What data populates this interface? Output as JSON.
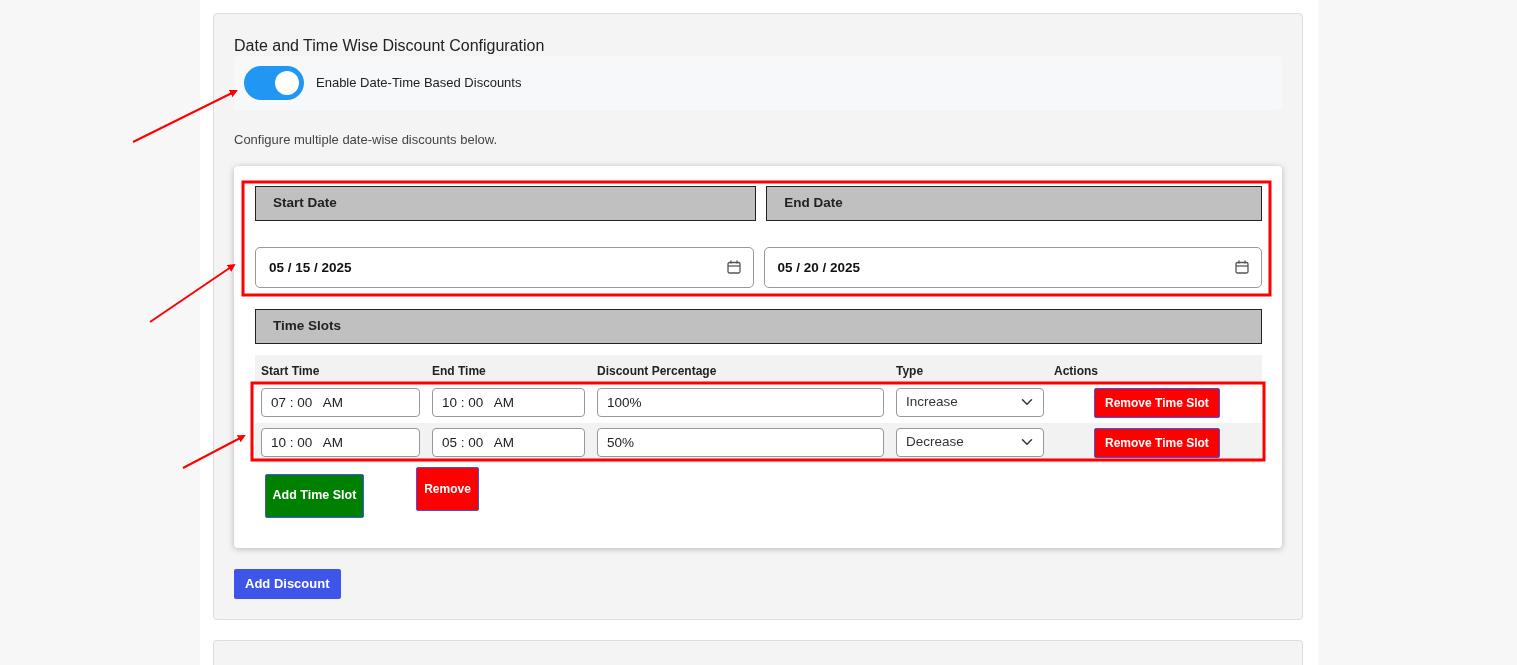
{
  "section_title": "Date and Time Wise Discount Configuration",
  "toggle": {
    "label": "Enable Date-Time Based Discounts",
    "on": true
  },
  "description": "Configure multiple date-wise discounts below.",
  "date_fields": [
    {
      "label": "Start Date",
      "value": "05 / 15 / 2025"
    },
    {
      "label": "End Date",
      "value": "05 / 20 / 2025"
    }
  ],
  "time_slots_heading": "Time Slots",
  "columns": [
    "Start Time",
    "End Time",
    "Discount Percentage",
    "Type",
    "Actions"
  ],
  "time_slots": [
    {
      "start": "07 : 00   AM",
      "end": "10 : 00   AM",
      "discount": "100%",
      "type": "Increase",
      "action": "Remove Time Slot"
    },
    {
      "start": "10 : 00   AM",
      "end": "05 : 00   AM",
      "discount": "50%",
      "type": "Decrease",
      "action": "Remove Time Slot"
    }
  ],
  "add_time_slot": "Add Time Slot",
  "remove": "Remove",
  "add_discount": "Add Discount"
}
